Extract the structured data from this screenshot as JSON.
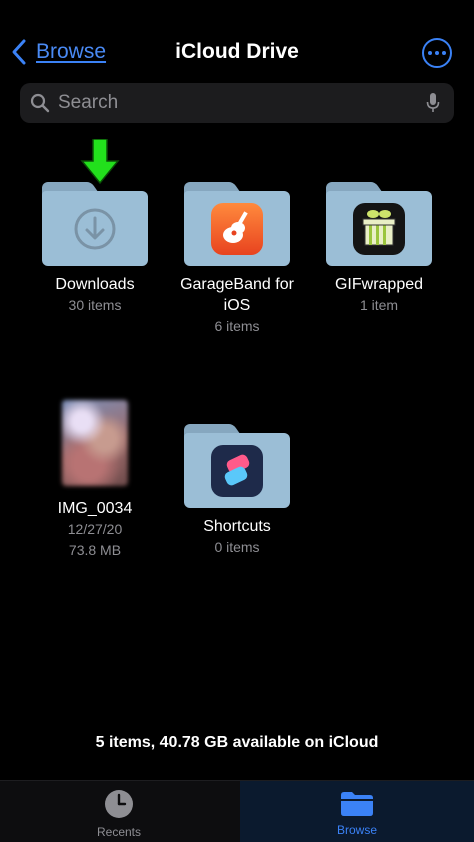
{
  "header": {
    "back_label": "Browse",
    "title": "iCloud Drive"
  },
  "search": {
    "placeholder": "Search"
  },
  "items": [
    {
      "name": "Downloads",
      "meta": [
        "30 items"
      ],
      "icon": "download-icon"
    },
    {
      "name": "GarageBand for iOS",
      "meta": [
        "6 items"
      ],
      "icon": "garageband-icon"
    },
    {
      "name": "GIFwrapped",
      "meta": [
        "1 item"
      ],
      "icon": "gifwrapped-icon"
    },
    {
      "name": "IMG_0034",
      "meta": [
        "12/27/20",
        "73.8 MB"
      ],
      "icon": "photo-thumbnail"
    },
    {
      "name": "Shortcuts",
      "meta": [
        "0 items"
      ],
      "icon": "shortcuts-icon"
    }
  ],
  "footer": {
    "storage": "5 items, 40.78 GB available on iCloud"
  },
  "tabbar": {
    "recents": "Recents",
    "browse": "Browse",
    "selected": "browse"
  },
  "colors": {
    "accent": "#3b82f6",
    "folder": "#9bbed6",
    "annotation_arrow": "#22e01c"
  }
}
